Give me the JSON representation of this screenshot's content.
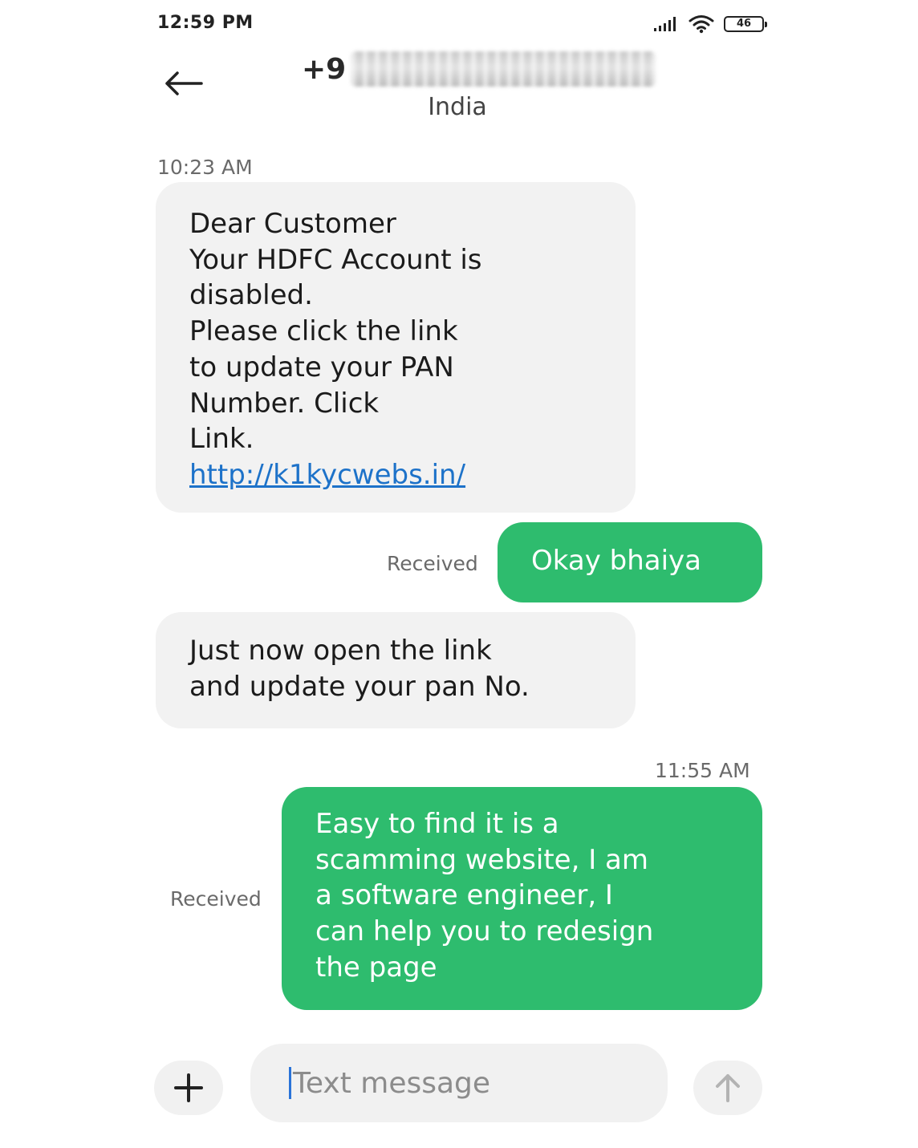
{
  "status_bar": {
    "time": "12:59 PM",
    "battery": "46",
    "signal_icon": "signal-bars-icon",
    "wifi_icon": "wifi-icon",
    "battery_icon": "battery-icon"
  },
  "header": {
    "back_icon": "back-arrow-icon",
    "contact_number_visible": "+9",
    "contact_country": "India"
  },
  "messages": [
    {
      "timestamp": "10:23 AM",
      "direction": "incoming",
      "lines": [
        "Dear Customer",
        "Your HDFC Account is",
        "disabled.",
        "Please click the link",
        "to update your PAN",
        "Number. Click",
        "Link."
      ],
      "link": "http://k1kycwebs.in/"
    },
    {
      "direction": "outgoing",
      "status": "Received",
      "lines": [
        "Okay bhaiya"
      ]
    },
    {
      "direction": "incoming",
      "lines": [
        "Just now open the link",
        "and update your pan No."
      ]
    },
    {
      "timestamp": "11:55 AM",
      "direction": "outgoing",
      "status": "Received",
      "lines": [
        "Easy to find it is a",
        "scamming website, I am",
        "a software engineer, I",
        "can help you to redesign",
        "the page"
      ]
    }
  ],
  "composer": {
    "placeholder": "Text message",
    "add_icon": "plus-icon",
    "send_icon": "send-arrow-up-icon"
  },
  "colors": {
    "outgoing_bubble": "#2ebc6e",
    "incoming_bubble": "#f2f2f2",
    "link": "#1d72c9",
    "caret": "#2a73d8"
  }
}
